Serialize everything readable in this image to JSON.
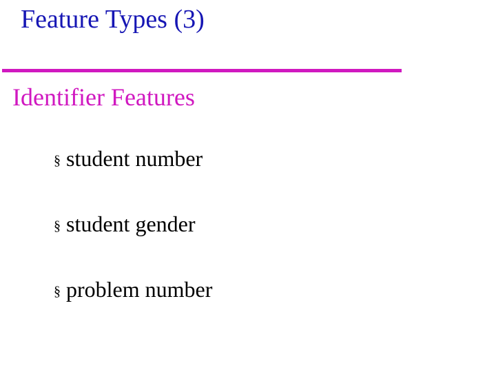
{
  "title": "Feature Types (3)",
  "subtitle": "Identifier Features",
  "bullet_glyph": "§",
  "items": [
    "student number",
    "student gender",
    "problem number"
  ]
}
